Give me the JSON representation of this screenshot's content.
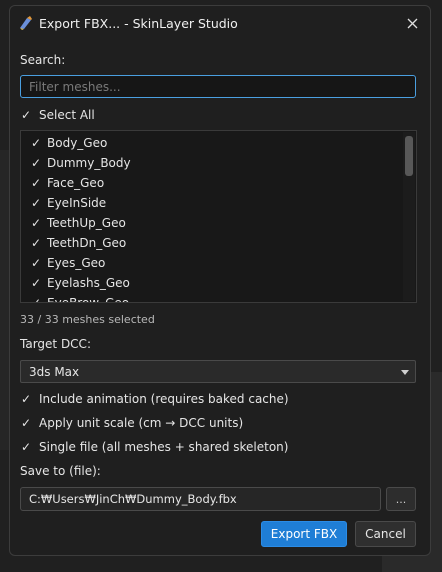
{
  "window": {
    "title": "Export FBX... - SkinLayer Studio"
  },
  "search": {
    "label": "Search:",
    "placeholder": "Filter meshes..."
  },
  "select_all": {
    "check": "✓",
    "label": "Select All"
  },
  "meshes": [
    {
      "name": "Body_Geo",
      "checked": true
    },
    {
      "name": "Dummy_Body",
      "checked": true
    },
    {
      "name": "Face_Geo",
      "checked": true
    },
    {
      "name": "EyeInSide",
      "checked": true
    },
    {
      "name": "TeethUp_Geo",
      "checked": true
    },
    {
      "name": "TeethDn_Geo",
      "checked": true
    },
    {
      "name": "Eyes_Geo",
      "checked": true
    },
    {
      "name": "Eyelashs_Geo",
      "checked": true
    },
    {
      "name": "EyeBrow_Geo",
      "checked": true
    }
  ],
  "check_glyph": "✓",
  "mesh_count": "33 / 33 meshes selected",
  "target": {
    "label": "Target DCC:",
    "value": "3ds Max"
  },
  "options": {
    "include_animation": "Include animation (requires baked cache)",
    "apply_unit_scale": "Apply unit scale (cm → DCC units)",
    "single_file": "Single file (all meshes + shared skeleton)"
  },
  "save": {
    "label": "Save to (file):",
    "path": "C:₩Users₩JinCh₩Dummy_Body.fbx",
    "browse": "..."
  },
  "buttons": {
    "export": "Export FBX",
    "cancel": "Cancel"
  },
  "colors": {
    "accent": "#1f7ed6",
    "focus_border": "#4a9fe0",
    "background": "#1f1f1f"
  }
}
